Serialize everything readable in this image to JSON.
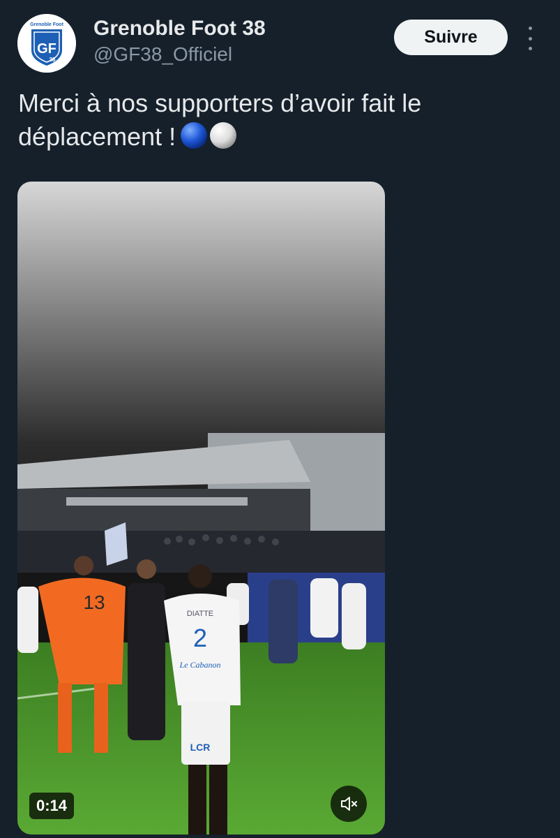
{
  "tweet": {
    "author_name": "Grenoble Foot 38",
    "author_handle": "@GF38_Officiel",
    "follow_label": "Suivre",
    "text_line1": "Merci à nos supporters d’avoir fait le",
    "text_line2": "déplacement !",
    "emojis": [
      "blue-ball-emoji",
      "white-ball-emoji"
    ],
    "avatar_logo_text": "Grenoble Foot",
    "avatar_monogram": "GF",
    "avatar_number": "38"
  },
  "video": {
    "duration": "0:14",
    "mute_icon": "speaker-muted-icon",
    "jersey_keeper_number": "13",
    "jersey_player_name": "DIATTE",
    "jersey_player_number": "2",
    "jersey_sponsor": "Le Cabanon",
    "shorts_text": "LCR"
  },
  "colors": {
    "background": "#15202b",
    "primary_text": "#e7e9ea",
    "secondary_text": "#8b98a5",
    "follow_button_bg": "#eff3f4",
    "club_blue": "#1d5fb5",
    "keeper_orange": "#f26a22",
    "pitch_green": "#4e9a2a"
  }
}
